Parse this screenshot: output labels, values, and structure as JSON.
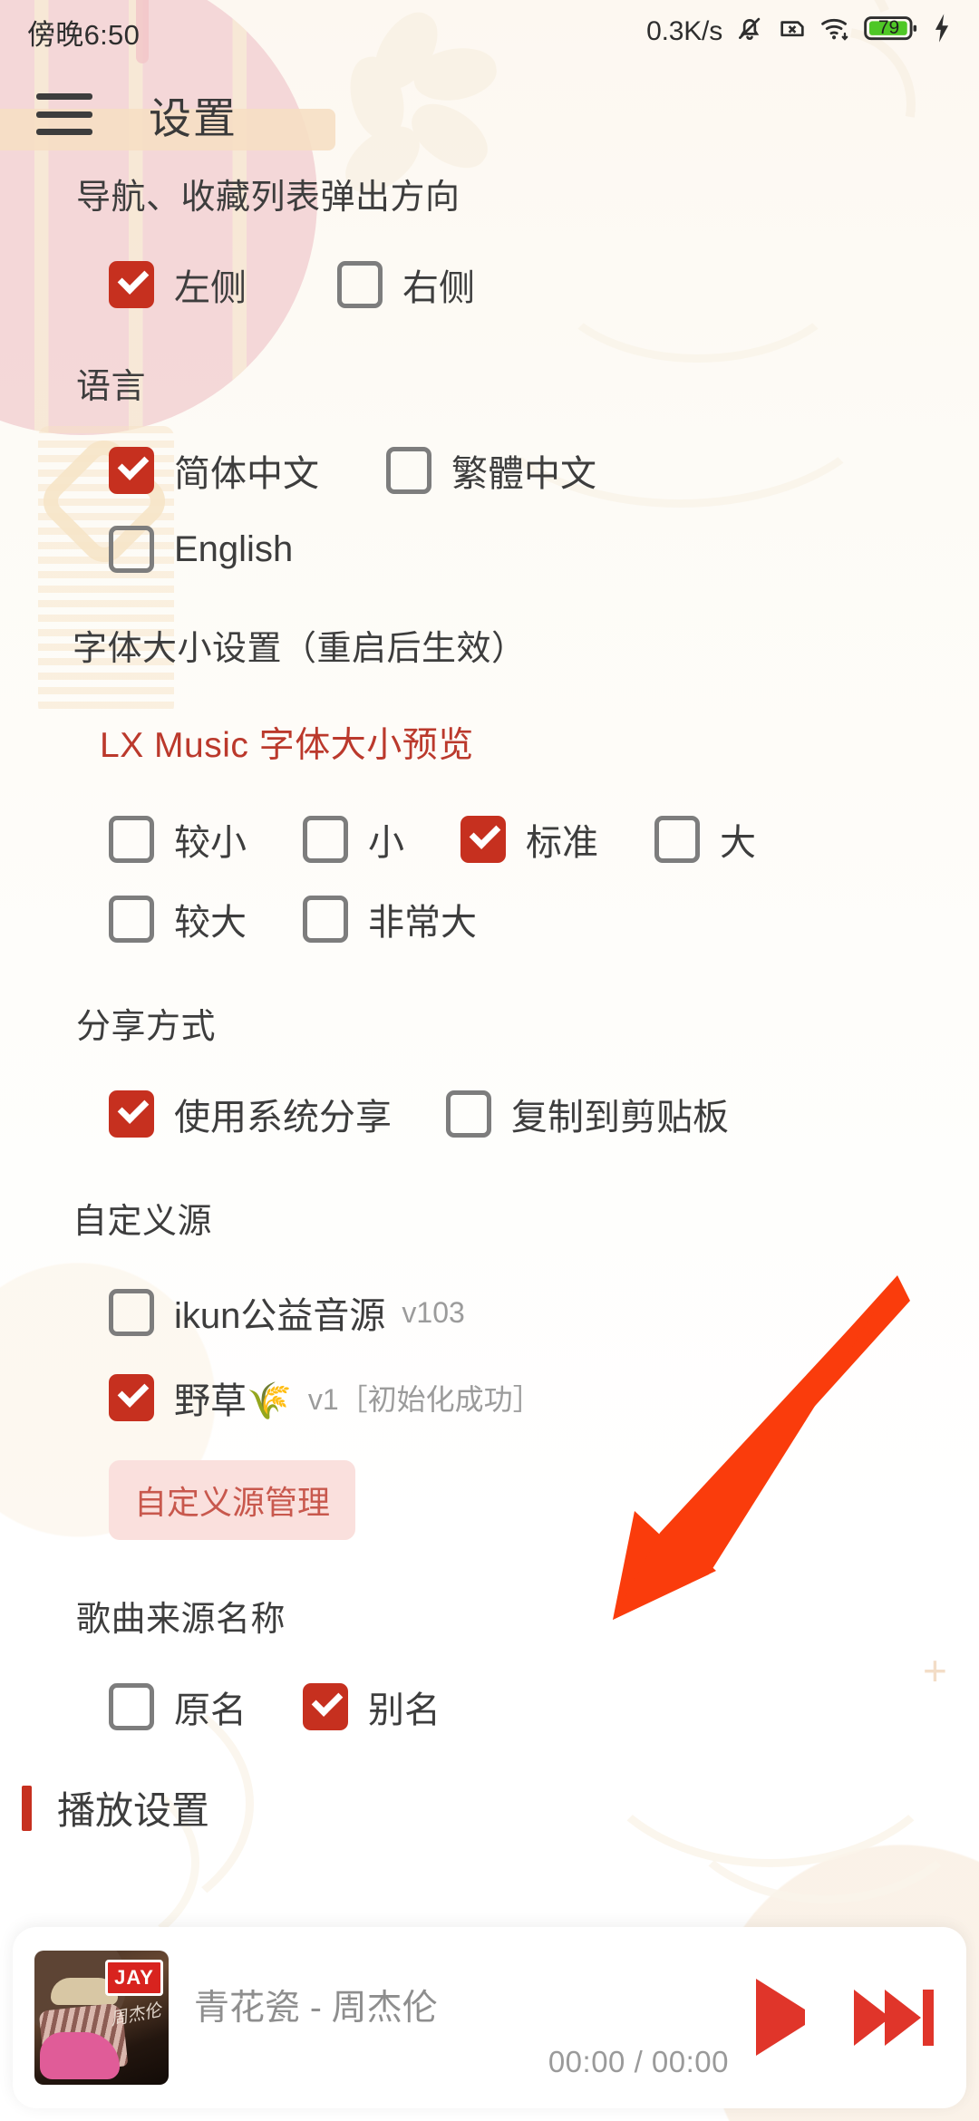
{
  "status_bar": {
    "clock": "傍晚6:50",
    "net_speed": "0.3K/s",
    "icons": [
      "bell-muted-icon",
      "sim-card-disabled-icon",
      "wifi-icon",
      "battery-icon",
      "charging-bolt-icon"
    ],
    "battery_percent": "79",
    "battery_color": "#4fc726"
  },
  "header": {
    "menu_icon": "hamburger-menu-icon",
    "title": "设置"
  },
  "theme": {
    "accent": "#c6301f",
    "accent_text": "#bb392c",
    "button_bg": "#fae0dd",
    "button_text": "#c8584d",
    "page_bg": "#fdfaf4"
  },
  "sections": [
    {
      "title": "导航、收藏列表弹出方向",
      "rows": [
        [
          {
            "label": "左侧",
            "checked": true
          },
          {
            "label": "右侧",
            "checked": false
          }
        ]
      ]
    },
    {
      "title": "语言",
      "rows": [
        [
          {
            "label": "简体中文",
            "checked": true
          },
          {
            "label": "繁體中文",
            "checked": false
          }
        ],
        [
          {
            "label": "English",
            "checked": false
          }
        ]
      ]
    },
    {
      "title": "字体大小设置（重启后生效）",
      "preview": "LX Music 字体大小预览",
      "rows": [
        [
          {
            "label": "较小",
            "checked": false
          },
          {
            "label": "小",
            "checked": false
          },
          {
            "label": "标准",
            "checked": true
          },
          {
            "label": "大",
            "checked": false
          }
        ],
        [
          {
            "label": "较大",
            "checked": false
          },
          {
            "label": "非常大",
            "checked": false
          }
        ]
      ]
    },
    {
      "title": "分享方式",
      "rows": [
        [
          {
            "label": "使用系统分享",
            "checked": true
          },
          {
            "label": "复制到剪贴板",
            "checked": false
          }
        ]
      ]
    },
    {
      "title": "自定义源",
      "rows": [
        [
          {
            "label": "ikun公益音源",
            "version": "v103",
            "checked": false
          }
        ],
        [
          {
            "label": "野草🌾",
            "version": "v1［初始化成功］",
            "checked": true
          }
        ]
      ],
      "button": "自定义源管理"
    },
    {
      "title": "歌曲来源名称",
      "rows": [
        [
          {
            "label": "原名",
            "checked": false
          },
          {
            "label": "别名",
            "checked": true
          }
        ]
      ]
    }
  ],
  "play_settings_heading": "播放设置",
  "player": {
    "album_art_label": "JAY",
    "album_signature": "周杰伦",
    "song": "青花瓷 - 周杰伦",
    "time": "00:00 / 00:00",
    "play_icon": "play-icon",
    "next_icon": "next-track-icon"
  },
  "annotation": {
    "arrow_color": "#fa3c0c",
    "name": "red-arrow-pointing-to-custom-source-manage"
  }
}
